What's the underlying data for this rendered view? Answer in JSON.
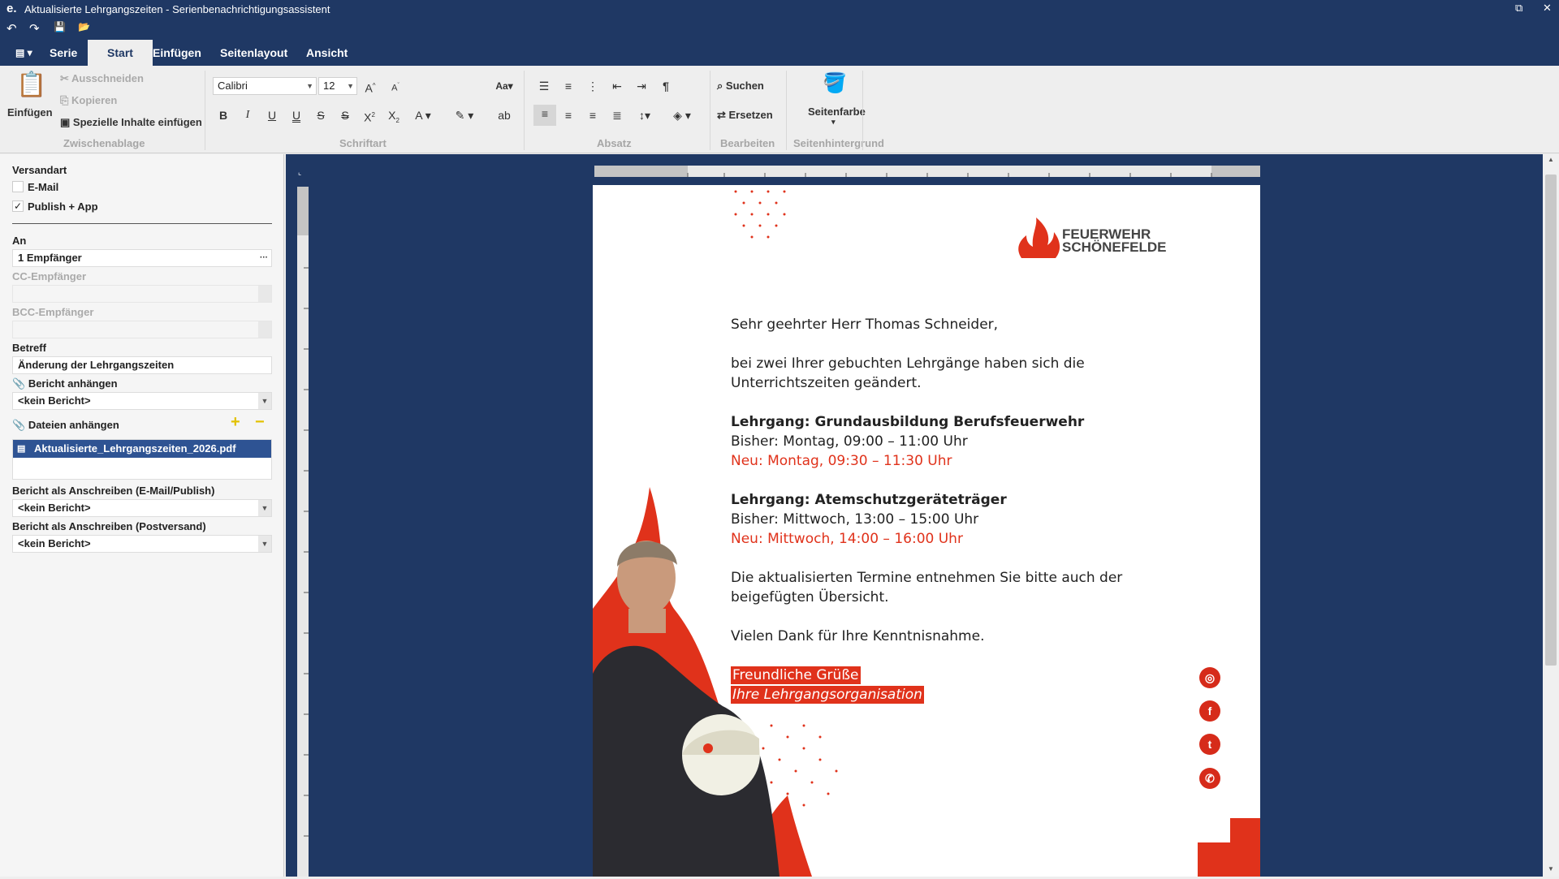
{
  "window": {
    "app_icon": "e.",
    "title": "Aktualisierte Lehrgangszeiten - Serienbenachrichtigungsassistent",
    "restore": "⧉",
    "close": "✕"
  },
  "qat": {
    "undo": "↶",
    "redo": "↷",
    "save": "💾",
    "open": "📂"
  },
  "tabs": [
    "Serie",
    "Start",
    "Einfügen",
    "Seitenlayout",
    "Ansicht"
  ],
  "active_tab": "Start",
  "ribbon": {
    "clipboard": {
      "paste": "Einfügen",
      "cut": "Ausschneiden",
      "copy": "Kopieren",
      "paste_special": "Spezielle Inhalte einfügen",
      "group": "Zwischenablage"
    },
    "font": {
      "family": "Calibri",
      "size": "12",
      "group": "Schriftart",
      "case": "Aa"
    },
    "paragraph": {
      "group": "Absatz"
    },
    "edit": {
      "search": "Suchen",
      "replace": "Ersetzen",
      "group": "Bearbeiten"
    },
    "background": {
      "page_color": "Seitenfarbe",
      "group": "Seitenhintergrund"
    }
  },
  "panel": {
    "versandart_label": "Versandart",
    "email_label": "E-Mail",
    "email_checked": false,
    "publish_label": "Publish + App",
    "publish_checked": true,
    "an_label": "An",
    "an_value": "1 Empfänger",
    "an_button": "···",
    "cc_label": "CC-Empfänger",
    "bcc_label": "BCC-Empfänger",
    "betreff_label": "Betreff",
    "betreff_value": "Änderung der Lehrgangszeiten",
    "bericht_anhaengen_label": "Bericht anhängen",
    "bericht_anhaengen_value": "<kein Bericht>",
    "dateien_label": "Dateien anhängen",
    "file_name": "Aktualisierte_Lehrgangszeiten_2026.pdf",
    "anschreiben_email_label": "Bericht als Anschreiben (E-Mail/Publish)",
    "anschreiben_email_value": "<kein Bericht>",
    "anschreiben_post_label": "Bericht als Anschreiben (Postversand)",
    "anschreiben_post_value": "<kein Bericht>"
  },
  "letter": {
    "logo_line1": "FEUERWEHR",
    "logo_line2": "SCHÖNEFELDE",
    "salutation": "Sehr geehrter Herr Thomas Schneider,",
    "intro_1": "bei zwei Ihrer gebuchten Lehrgänge haben sich die",
    "intro_2": "Unterrichtszeiten geändert.",
    "course1_title": "Lehrgang: Grundausbildung Berufsfeuerwehr",
    "course1_old": "Bisher: Montag, 09:00 – 11:00 Uhr",
    "course1_new": "Neu: Montag, 09:30 – 11:30 Uhr",
    "course2_title": "Lehrgang: Atemschutzgeräteträger",
    "course2_old": "Bisher: Mittwoch, 13:00 – 15:00 Uhr",
    "course2_new": "Neu: Mittwoch, 14:00 – 16:00 Uhr",
    "note_1": "Die aktualisierten Termine entnehmen Sie bitte auch der",
    "note_2": "beigefügten Übersicht.",
    "thanks": "Vielen Dank für Ihre Kenntnisnahme.",
    "closing_1": "Freundliche Grüße",
    "closing_2": "Ihre Lehrgangsorganisation"
  },
  "social": [
    "instagram-icon",
    "facebook-icon",
    "twitter-icon",
    "whatsapp-icon"
  ],
  "colors": {
    "navy": "#1f3864",
    "red": "#e0321b"
  }
}
